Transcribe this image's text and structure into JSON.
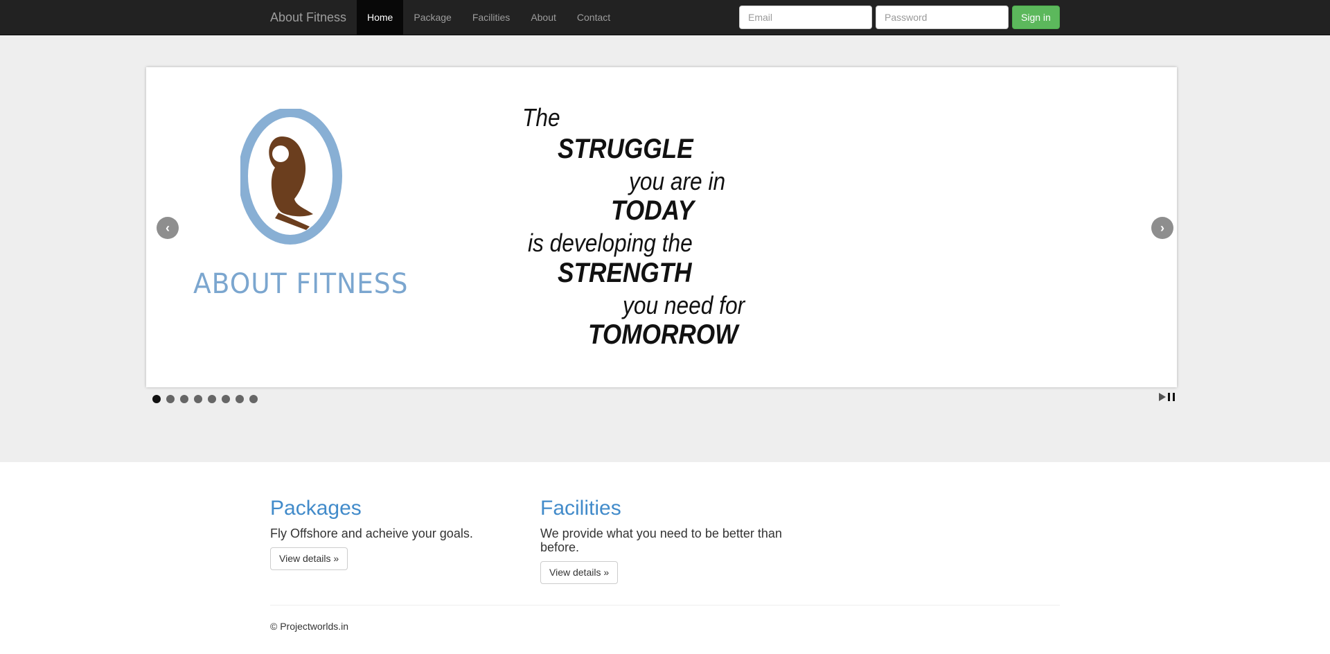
{
  "navbar": {
    "brand": "About Fitness",
    "items": [
      {
        "label": "Home"
      },
      {
        "label": "Package"
      },
      {
        "label": "Facilities"
      },
      {
        "label": "About"
      },
      {
        "label": "Contact"
      }
    ],
    "active_index": 0,
    "email_placeholder": "Email",
    "password_placeholder": "Password",
    "signin_label": "Sign in"
  },
  "slider": {
    "logo_text": "ABOUT FITNESS",
    "quote": {
      "line1": "The",
      "line2": "STRUGGLE",
      "line3": "you are in",
      "line4": "TODAY",
      "line5": "is developing the",
      "line6": "STRENGTH",
      "line7": "you need for",
      "line8": "TOMORROW"
    },
    "prev_icon": "chevron-left-icon",
    "next_icon": "chevron-right-icon",
    "slide_count": 8,
    "current_slide": 1
  },
  "sections": [
    {
      "heading": "Packages",
      "text": "Fly Offshore and acheive your goals.",
      "button": "View details »"
    },
    {
      "heading": "Facilities",
      "text": "We provide what you need to be better than before.",
      "button": "View details »"
    }
  ],
  "footer": {
    "text": "© Projectworlds.in"
  },
  "colors": {
    "navbar_bg": "#222222",
    "accent_blue": "#428bca",
    "signin_green": "#5cb85c",
    "jumbotron_bg": "#eeeeee",
    "logo_blue": "#7ba6cf",
    "logo_brown": "#6b3e1e"
  }
}
